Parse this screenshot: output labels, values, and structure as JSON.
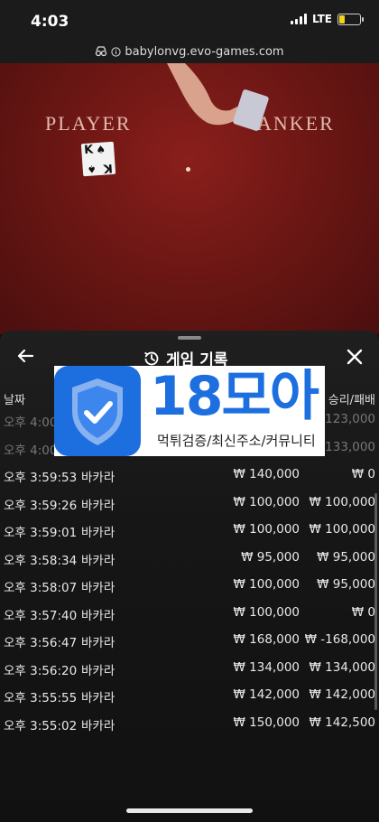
{
  "status_bar": {
    "time": "4:03",
    "network": "LTE",
    "battery_color": "#f2d21b"
  },
  "browser": {
    "url": "babylonvg.evo-games.com"
  },
  "video": {
    "player_label": "PLAYER",
    "banker_label": "ANKER",
    "card": {
      "rank": "K",
      "suit": "♠"
    }
  },
  "panel": {
    "title": "게임 기록",
    "back_icon": "arrow-left-icon",
    "close_icon": "close-icon",
    "history_icon": "history-icon",
    "columns": {
      "date": "날짜",
      "result": "승리/패배"
    },
    "rows": [
      {
        "time": "오후 4:00",
        "game": "",
        "bet": "",
        "win": "123,000",
        "faded": true
      },
      {
        "time": "오후 4:00",
        "game": "",
        "bet": "",
        "win": "133,000",
        "faded": true
      },
      {
        "time": "오후 3:59:53",
        "game": "바카라",
        "bet": "₩ 140,000",
        "win": "₩ 0"
      },
      {
        "time": "오후 3:59:26",
        "game": "바카라",
        "bet": "₩ 100,000",
        "win": "₩ 100,000"
      },
      {
        "time": "오후 3:59:01",
        "game": "바카라",
        "bet": "₩ 100,000",
        "win": "₩ 100,000"
      },
      {
        "time": "오후 3:58:34",
        "game": "바카라",
        "bet": "₩ 95,000",
        "win": "₩ 95,000"
      },
      {
        "time": "오후 3:58:07",
        "game": "바카라",
        "bet": "₩ 100,000",
        "win": "₩ 95,000"
      },
      {
        "time": "오후 3:57:40",
        "game": "바카라",
        "bet": "₩ 100,000",
        "win": "₩ 0"
      },
      {
        "time": "오후 3:56:47",
        "game": "바카라",
        "bet": "₩ 168,000",
        "win": "₩ -168,000"
      },
      {
        "time": "오후 3:56:20",
        "game": "바카라",
        "bet": "₩ 134,000",
        "win": "₩ 134,000"
      },
      {
        "time": "오후 3:55:55",
        "game": "바카라",
        "bet": "₩ 142,000",
        "win": "₩ 142,000"
      },
      {
        "time": "오후 3:55:02",
        "game": "바카라",
        "bet": "₩ 150,000",
        "win": "₩ 142,500"
      }
    ]
  },
  "ad": {
    "title": "18모아",
    "subtitle": "먹튀검증/최신주소/커뮤니티",
    "brand_color": "#1d6fe0"
  }
}
